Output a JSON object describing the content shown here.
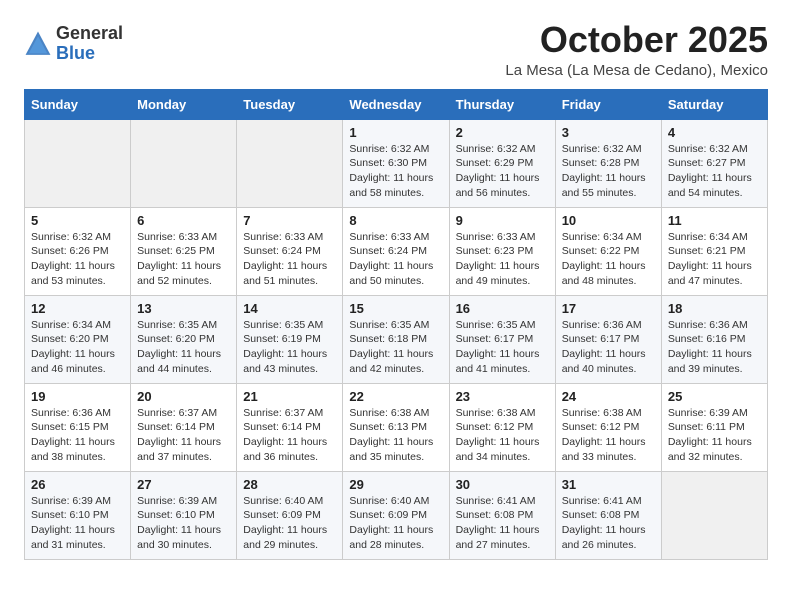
{
  "logo": {
    "general": "General",
    "blue": "Blue"
  },
  "title": "October 2025",
  "subtitle": "La Mesa (La Mesa de Cedano), Mexico",
  "days_of_week": [
    "Sunday",
    "Monday",
    "Tuesday",
    "Wednesday",
    "Thursday",
    "Friday",
    "Saturday"
  ],
  "weeks": [
    [
      {
        "day": "",
        "info": ""
      },
      {
        "day": "",
        "info": ""
      },
      {
        "day": "",
        "info": ""
      },
      {
        "day": "1",
        "info": "Sunrise: 6:32 AM\nSunset: 6:30 PM\nDaylight: 11 hours and 58 minutes."
      },
      {
        "day": "2",
        "info": "Sunrise: 6:32 AM\nSunset: 6:29 PM\nDaylight: 11 hours and 56 minutes."
      },
      {
        "day": "3",
        "info": "Sunrise: 6:32 AM\nSunset: 6:28 PM\nDaylight: 11 hours and 55 minutes."
      },
      {
        "day": "4",
        "info": "Sunrise: 6:32 AM\nSunset: 6:27 PM\nDaylight: 11 hours and 54 minutes."
      }
    ],
    [
      {
        "day": "5",
        "info": "Sunrise: 6:32 AM\nSunset: 6:26 PM\nDaylight: 11 hours and 53 minutes."
      },
      {
        "day": "6",
        "info": "Sunrise: 6:33 AM\nSunset: 6:25 PM\nDaylight: 11 hours and 52 minutes."
      },
      {
        "day": "7",
        "info": "Sunrise: 6:33 AM\nSunset: 6:24 PM\nDaylight: 11 hours and 51 minutes."
      },
      {
        "day": "8",
        "info": "Sunrise: 6:33 AM\nSunset: 6:24 PM\nDaylight: 11 hours and 50 minutes."
      },
      {
        "day": "9",
        "info": "Sunrise: 6:33 AM\nSunset: 6:23 PM\nDaylight: 11 hours and 49 minutes."
      },
      {
        "day": "10",
        "info": "Sunrise: 6:34 AM\nSunset: 6:22 PM\nDaylight: 11 hours and 48 minutes."
      },
      {
        "day": "11",
        "info": "Sunrise: 6:34 AM\nSunset: 6:21 PM\nDaylight: 11 hours and 47 minutes."
      }
    ],
    [
      {
        "day": "12",
        "info": "Sunrise: 6:34 AM\nSunset: 6:20 PM\nDaylight: 11 hours and 46 minutes."
      },
      {
        "day": "13",
        "info": "Sunrise: 6:35 AM\nSunset: 6:20 PM\nDaylight: 11 hours and 44 minutes."
      },
      {
        "day": "14",
        "info": "Sunrise: 6:35 AM\nSunset: 6:19 PM\nDaylight: 11 hours and 43 minutes."
      },
      {
        "day": "15",
        "info": "Sunrise: 6:35 AM\nSunset: 6:18 PM\nDaylight: 11 hours and 42 minutes."
      },
      {
        "day": "16",
        "info": "Sunrise: 6:35 AM\nSunset: 6:17 PM\nDaylight: 11 hours and 41 minutes."
      },
      {
        "day": "17",
        "info": "Sunrise: 6:36 AM\nSunset: 6:17 PM\nDaylight: 11 hours and 40 minutes."
      },
      {
        "day": "18",
        "info": "Sunrise: 6:36 AM\nSunset: 6:16 PM\nDaylight: 11 hours and 39 minutes."
      }
    ],
    [
      {
        "day": "19",
        "info": "Sunrise: 6:36 AM\nSunset: 6:15 PM\nDaylight: 11 hours and 38 minutes."
      },
      {
        "day": "20",
        "info": "Sunrise: 6:37 AM\nSunset: 6:14 PM\nDaylight: 11 hours and 37 minutes."
      },
      {
        "day": "21",
        "info": "Sunrise: 6:37 AM\nSunset: 6:14 PM\nDaylight: 11 hours and 36 minutes."
      },
      {
        "day": "22",
        "info": "Sunrise: 6:38 AM\nSunset: 6:13 PM\nDaylight: 11 hours and 35 minutes."
      },
      {
        "day": "23",
        "info": "Sunrise: 6:38 AM\nSunset: 6:12 PM\nDaylight: 11 hours and 34 minutes."
      },
      {
        "day": "24",
        "info": "Sunrise: 6:38 AM\nSunset: 6:12 PM\nDaylight: 11 hours and 33 minutes."
      },
      {
        "day": "25",
        "info": "Sunrise: 6:39 AM\nSunset: 6:11 PM\nDaylight: 11 hours and 32 minutes."
      }
    ],
    [
      {
        "day": "26",
        "info": "Sunrise: 6:39 AM\nSunset: 6:10 PM\nDaylight: 11 hours and 31 minutes."
      },
      {
        "day": "27",
        "info": "Sunrise: 6:39 AM\nSunset: 6:10 PM\nDaylight: 11 hours and 30 minutes."
      },
      {
        "day": "28",
        "info": "Sunrise: 6:40 AM\nSunset: 6:09 PM\nDaylight: 11 hours and 29 minutes."
      },
      {
        "day": "29",
        "info": "Sunrise: 6:40 AM\nSunset: 6:09 PM\nDaylight: 11 hours and 28 minutes."
      },
      {
        "day": "30",
        "info": "Sunrise: 6:41 AM\nSunset: 6:08 PM\nDaylight: 11 hours and 27 minutes."
      },
      {
        "day": "31",
        "info": "Sunrise: 6:41 AM\nSunset: 6:08 PM\nDaylight: 11 hours and 26 minutes."
      },
      {
        "day": "",
        "info": ""
      }
    ]
  ]
}
